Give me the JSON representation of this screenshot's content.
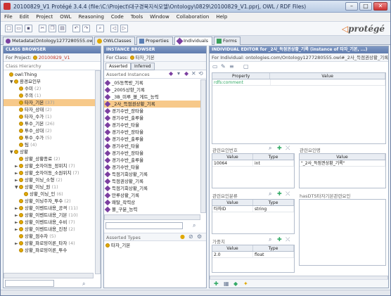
{
  "window": {
    "title": "20100829_V1  Protégé 3.4.4   (file:\\C:\\Project\\대구경북지식모델\\Ontology\\0829\\20100829_V1.pprj, OWL / RDF Files)",
    "min": "–",
    "max": "□",
    "close": "✕"
  },
  "menu": [
    "File",
    "Edit",
    "Project",
    "OWL",
    "Reasoning",
    "Code",
    "Tools",
    "Window",
    "Collaboration",
    "Help"
  ],
  "logo": "protégé",
  "tabs": [
    {
      "label": "Metadata(Ontology1277280555.owl)",
      "color": "#7b3fa0"
    },
    {
      "label": "OWLClasses",
      "color": "#e0a800"
    },
    {
      "label": "Properties",
      "color": "#5b7fb5"
    },
    {
      "label": "Individuals",
      "color": "#7b3fa0"
    },
    {
      "label": "Forms",
      "color": "#3aa05a"
    }
  ],
  "class_browser": {
    "header": "CLASS BROWSER",
    "project_label": "For Project:",
    "project_name": "20100829_V1",
    "hierarchy_label": "Class Hierarchy",
    "items": [
      {
        "indent": 0,
        "toggle": "",
        "label": "owl:Thing",
        "count": ""
      },
      {
        "indent": 1,
        "toggle": "▼",
        "label": "환경요인부",
        "count": ""
      },
      {
        "indent": 2,
        "toggle": "",
        "label": "수미",
        "count": "(2)"
      },
      {
        "indent": 2,
        "toggle": "",
        "label": "주의",
        "count": "(1)"
      },
      {
        "indent": 2,
        "toggle": "",
        "label": "타자_기본",
        "count": "(37)",
        "selected": true
      },
      {
        "indent": 2,
        "toggle": "",
        "label": "타자_상태",
        "count": "(2)"
      },
      {
        "indent": 2,
        "toggle": "",
        "label": "타자_수가",
        "count": "(1)"
      },
      {
        "indent": 2,
        "toggle": "",
        "label": "투수_기본",
        "count": "(26)"
      },
      {
        "indent": 2,
        "toggle": "",
        "label": "투수_상대",
        "count": "(2)"
      },
      {
        "indent": 2,
        "toggle": "",
        "label": "투수_수가",
        "count": "(5)"
      },
      {
        "indent": 2,
        "toggle": "",
        "label": "팀",
        "count": "(4)"
      },
      {
        "indent": 1,
        "toggle": "▼",
        "label": "상황",
        "count": ""
      },
      {
        "indent": 2,
        "toggle": "",
        "label": "상황_상황종료",
        "count": "(2)"
      },
      {
        "indent": 2,
        "toggle": "►",
        "label": "상황_숫자이동_정위치",
        "count": "(7)"
      },
      {
        "indent": 2,
        "toggle": "►",
        "label": "상황_숫자이동_소원위치",
        "count": "(7)"
      },
      {
        "indent": 2,
        "toggle": "►",
        "label": "상황_이닝_소형",
        "count": "(2)"
      },
      {
        "indent": 2,
        "toggle": "▼",
        "label": "상황_이닝_원",
        "count": "(1)"
      },
      {
        "indent": 3,
        "toggle": "",
        "label": "상황_이닝_인",
        "count": "(6)"
      },
      {
        "indent": 2,
        "toggle": "",
        "label": "상황_이닝주자_투수",
        "count": "(2)"
      },
      {
        "indent": 2,
        "toggle": "►",
        "label": "상황_이벤트내용_공격",
        "count": "(11)"
      },
      {
        "indent": 2,
        "toggle": "►",
        "label": "상황_이벤트내용_기본",
        "count": "(10)"
      },
      {
        "indent": 2,
        "toggle": "►",
        "label": "상황_이벤트내용_수비",
        "count": "(7)"
      },
      {
        "indent": 2,
        "toggle": "►",
        "label": "상황_이벤트내용_진정",
        "count": "(2)"
      },
      {
        "indent": 2,
        "toggle": "",
        "label": "상황_점수차",
        "count": "(5)"
      },
      {
        "indent": 2,
        "toggle": "►",
        "label": "상황_파로밍이론_타자",
        "count": "(4)"
      },
      {
        "indent": 2,
        "toggle": "",
        "label": "상황_파로밍이론_투수",
        "count": ""
      }
    ]
  },
  "instance_browser": {
    "header": "INSTANCE BROWSER",
    "for_class_label": "For Class:",
    "for_class_name": "타자_기본",
    "tab_asserted": "Asserted",
    "tab_inferred": "Inferred",
    "instances_label": "Asserted Instances",
    "instances": [
      "_05동쪽방_기록",
      "_2005상향_기록",
      "_3B_미루_볼_게트_능력",
      "_2사_득점권상황_기록",
      "경기수반_장타율",
      "경기수반_출루율",
      "경기수반_타율",
      "경기수반_장타율",
      "경기수반_출루율",
      "경기수반_타율",
      "경기수반_장타율",
      "경기수반_출루율",
      "경기수반_타율",
      "득점기회상황_기록",
      "득점권상황_기록",
      "득점기회상황_기록",
      "만루상황_기록",
      "왜탈_작력상",
      "볼_구분_능력"
    ],
    "types_label": "Asserted Types",
    "types": [
      "타자_기본"
    ]
  },
  "individual_editor": {
    "header": "INDIVIDUAL EDITOR for _2사_득점권상황_기록   (instance of 타자_기본, ...)",
    "for_label": "For Individual:",
    "individual_uri": "ontologies.com/Ontology1277280555.owl#_2사_득점권상황_기록",
    "property_col": "Property",
    "value_col": "Value",
    "properties": [
      {
        "property": "rdfs:comment",
        "value": ""
      }
    ],
    "boxes": [
      {
        "label": "관련요인번호",
        "col1": "Value",
        "col2": "Type",
        "rows": [
          {
            "value": "10064",
            "type": "int"
          }
        ]
      },
      {
        "label": "관련요인명",
        "col1": "Value",
        "col2": "",
        "rows": [
          {
            "value": "\"_2사_득점권상황_기록\"",
            "type": ""
          }
        ]
      },
      {
        "label": "관련요인분류",
        "col1": "Value",
        "col2": "Type",
        "rows": [
          {
            "value": "타자ID",
            "type": "string"
          }
        ]
      },
      {
        "label": "hasDTS타자기본관련요인",
        "col1": "",
        "col2": "",
        "rows": []
      },
      {
        "label": "가중치",
        "col1": "Value",
        "col2": "Type",
        "rows": [
          {
            "value": "2.0",
            "type": "float"
          }
        ]
      }
    ]
  }
}
